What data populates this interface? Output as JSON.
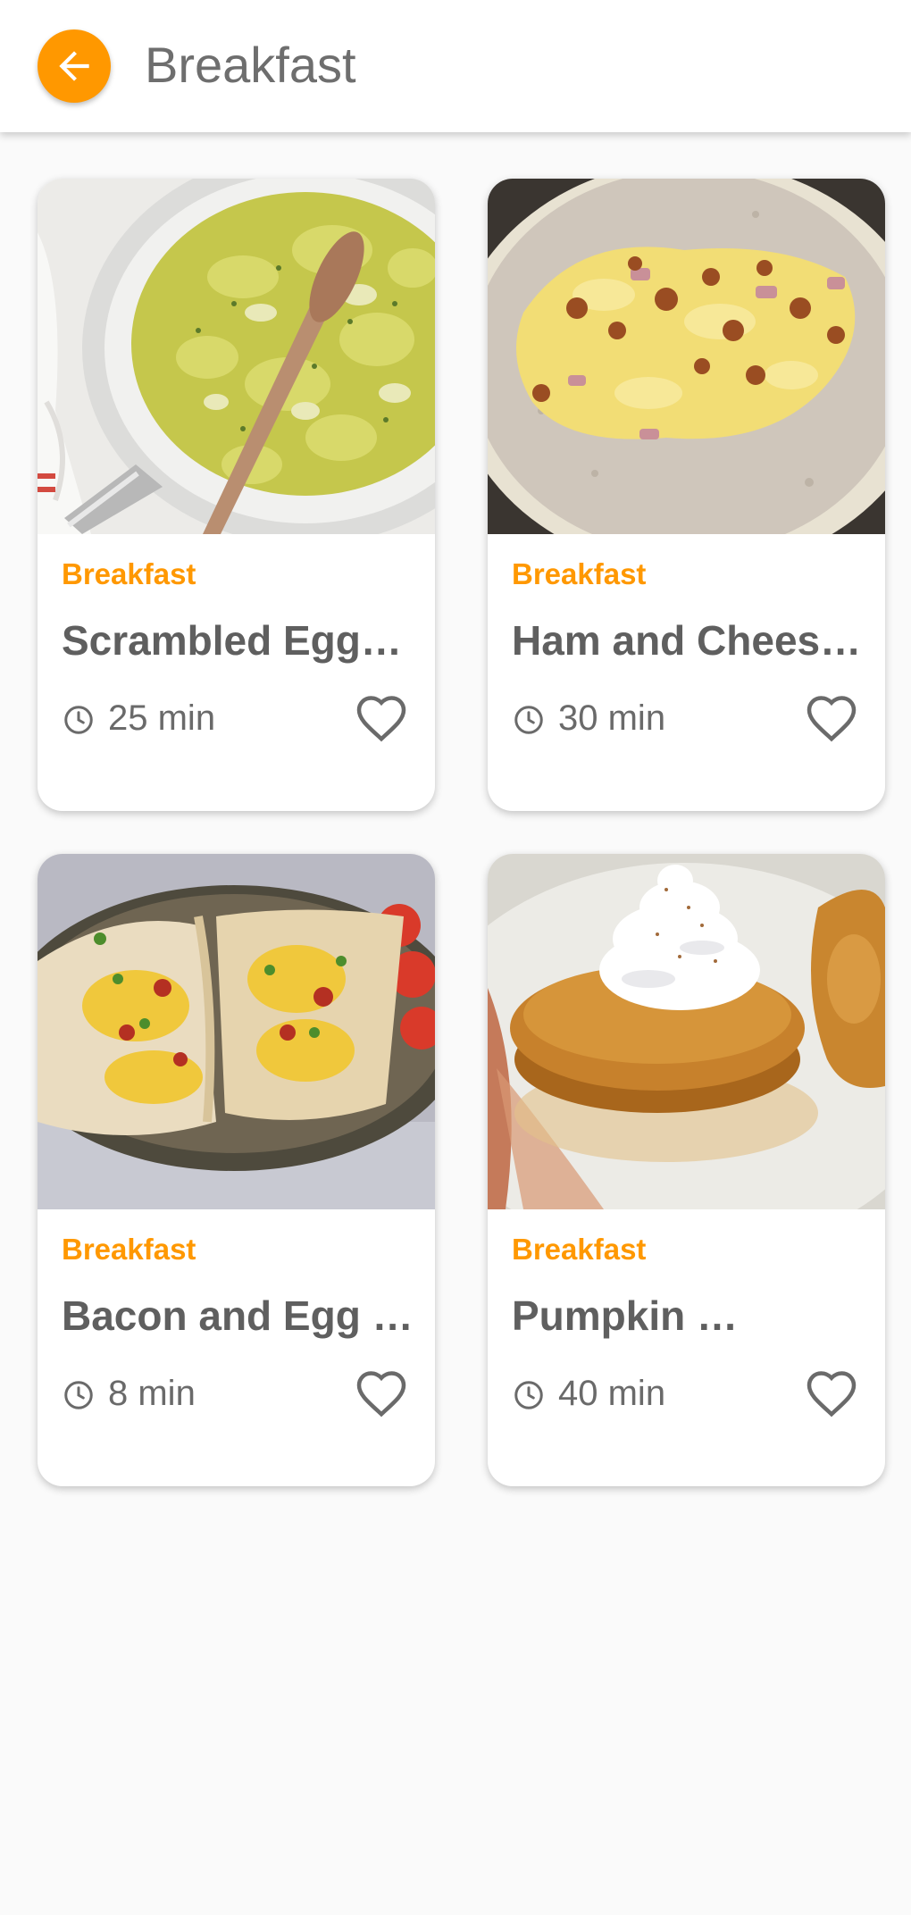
{
  "header": {
    "title": "Breakfast",
    "back_icon": "arrow-left-icon"
  },
  "colors": {
    "accent": "#ff9800",
    "title_text": "#6e6e6e",
    "card_title": "#5f5f5f",
    "background": "#fafafa"
  },
  "recipes": [
    {
      "category": "Breakfast",
      "name": "Scrambled Egg…",
      "time": "25 min",
      "image": "scrambled eggs in skillet with wooden spoon"
    },
    {
      "category": "Breakfast",
      "name": "Ham and Chees…",
      "time": "30 min",
      "image": "ham and cheese egg tortilla"
    },
    {
      "category": "Breakfast",
      "name": "Bacon and Egg …",
      "time": "8 min",
      "image": "bacon and egg tacos with tomatoes"
    },
    {
      "category": "Breakfast",
      "name": "Pumpkin …",
      "time": "40 min",
      "image": "pumpkin pancakes with whipped cream"
    }
  ],
  "icons": {
    "time": "clock-icon",
    "favorite": "heart-outline-icon"
  }
}
